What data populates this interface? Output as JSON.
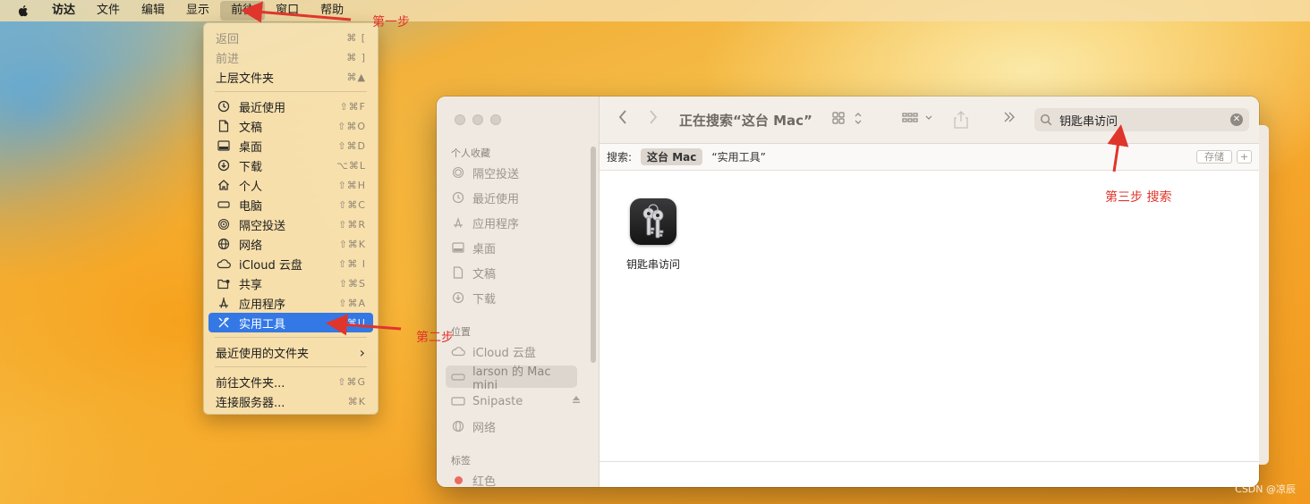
{
  "menubar": {
    "app_name": "访达",
    "items": [
      "文件",
      "编辑",
      "显示",
      "前往",
      "窗口",
      "帮助"
    ]
  },
  "go_menu": {
    "group1": [
      {
        "label": "返回",
        "shortcut": "⌘ [",
        "disabled": true
      },
      {
        "label": "前进",
        "shortcut": "⌘ ]",
        "disabled": true
      },
      {
        "label": "上层文件夹",
        "shortcut": "⌘▲",
        "disabled": false
      }
    ],
    "group2": [
      {
        "label": "最近使用",
        "shortcut": "⇧⌘F",
        "icon": "clock-icon"
      },
      {
        "label": "文稿",
        "shortcut": "⇧⌘O",
        "icon": "document-icon"
      },
      {
        "label": "桌面",
        "shortcut": "⇧⌘D",
        "icon": "desktop-icon"
      },
      {
        "label": "下载",
        "shortcut": "⌥⌘L",
        "icon": "download-icon"
      },
      {
        "label": "个人",
        "shortcut": "⇧⌘H",
        "icon": "home-icon"
      },
      {
        "label": "电脑",
        "shortcut": "⇧⌘C",
        "icon": "computer-icon"
      },
      {
        "label": "隔空投送",
        "shortcut": "⇧⌘R",
        "icon": "airdrop-icon"
      },
      {
        "label": "网络",
        "shortcut": "⇧⌘K",
        "icon": "network-icon"
      },
      {
        "label": "iCloud 云盘",
        "shortcut": "⇧⌘ I",
        "icon": "cloud-icon"
      },
      {
        "label": "共享",
        "shortcut": "⇧⌘S",
        "icon": "shared-folder-icon"
      },
      {
        "label": "应用程序",
        "shortcut": "⇧⌘A",
        "icon": "apps-icon"
      },
      {
        "label": "实用工具",
        "shortcut": "⇧⌘U",
        "icon": "tools-icon",
        "selected": true
      }
    ],
    "recent_folders": {
      "label": "最近使用的文件夹",
      "arrow": "›"
    },
    "group3": [
      {
        "label": "前往文件夹...",
        "shortcut": "⇧⌘G"
      },
      {
        "label": "连接服务器...",
        "shortcut": "⌘K"
      }
    ]
  },
  "annotations": {
    "step1": "第一步",
    "step2": "第二步",
    "step3": "第三步 搜索"
  },
  "finder": {
    "title": "正在搜索“这台 Mac”",
    "search": {
      "value": "钥匙串访问"
    },
    "sidebar": {
      "favorites_header": "个人收藏",
      "favorites": [
        {
          "label": "隔空投送",
          "icon": "airdrop-icon"
        },
        {
          "label": "最近使用",
          "icon": "clock-icon"
        },
        {
          "label": "应用程序",
          "icon": "apps-icon"
        },
        {
          "label": "桌面",
          "icon": "desktop-icon"
        },
        {
          "label": "文稿",
          "icon": "document-icon"
        },
        {
          "label": "下载",
          "icon": "download-icon"
        }
      ],
      "locations_header": "位置",
      "locations": [
        {
          "label": "iCloud 云盘",
          "icon": "cloud-icon"
        },
        {
          "label": "larson 的 Mac mini",
          "icon": "mac-mini-icon",
          "active": true
        },
        {
          "label": "Snipaste",
          "icon": "disk-icon"
        },
        {
          "label": "网络",
          "icon": "network-icon"
        }
      ],
      "tags_header": "标签",
      "tags": [
        {
          "label": "红色",
          "color": "#ec6b60"
        }
      ]
    },
    "scope": {
      "label": "搜索:",
      "active": "这台 Mac",
      "alternative": "“实用工具”",
      "save_label": "存储",
      "add_label": "+"
    },
    "results": [
      {
        "name": "钥匙串访问",
        "icon": "keychain-icon"
      }
    ]
  },
  "watermark": "CSDN @凉辰",
  "colors": {
    "accent": "#3478e6",
    "annotation": "#e0352b"
  }
}
